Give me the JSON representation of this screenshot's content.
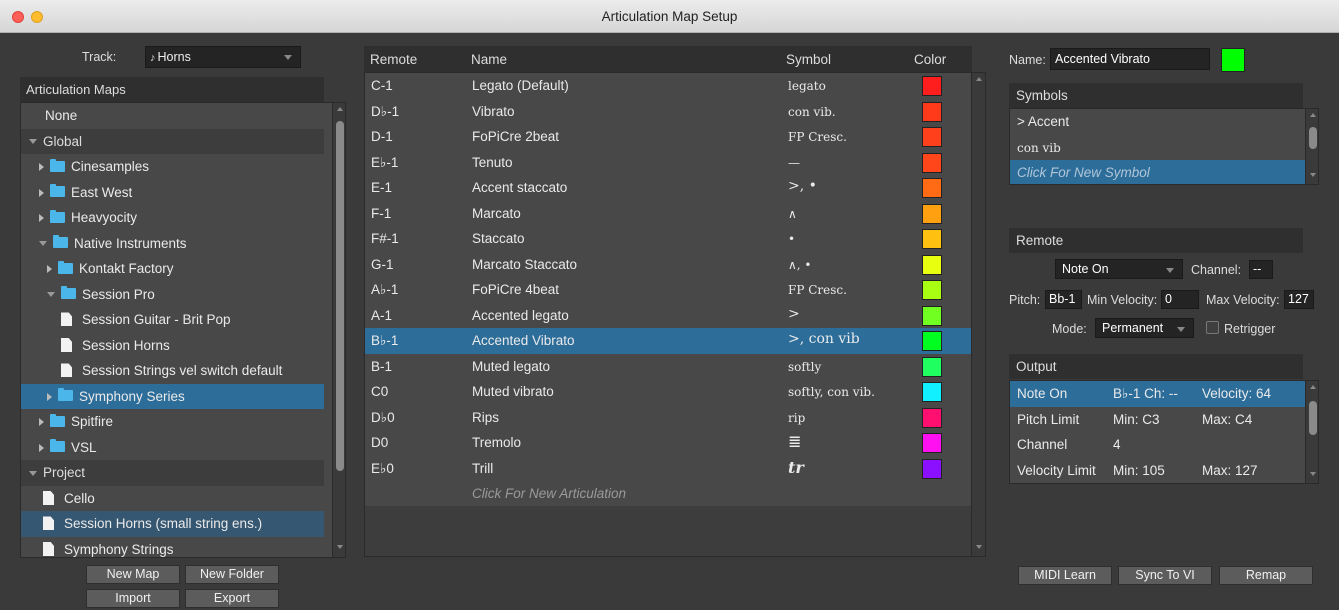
{
  "window": {
    "title": "Articulation Map Setup"
  },
  "left": {
    "track_label": "Track:",
    "track_value": "Horns",
    "maps_header": "Articulation Maps",
    "tree": [
      {
        "label": "None",
        "kind": "item",
        "indent": 0
      },
      {
        "label": "Global",
        "kind": "section",
        "indent": 0
      },
      {
        "label": "Cinesamples",
        "kind": "folder-closed",
        "indent": 1
      },
      {
        "label": "East West",
        "kind": "folder-closed",
        "indent": 1
      },
      {
        "label": "Heavyocity",
        "kind": "folder-closed",
        "indent": 1
      },
      {
        "label": "Native Instruments",
        "kind": "folder-open",
        "indent": 1
      },
      {
        "label": "Kontakt Factory",
        "kind": "folder-closed",
        "indent": 2
      },
      {
        "label": "Session Pro",
        "kind": "folder-open",
        "indent": 2
      },
      {
        "label": "Session Guitar - Brit Pop",
        "kind": "doc",
        "indent": 3
      },
      {
        "label": "Session Horns",
        "kind": "doc",
        "indent": 3
      },
      {
        "label": "Session Strings vel switch default",
        "kind": "doc",
        "indent": 3
      },
      {
        "label": "Symphony Series",
        "kind": "folder-closed",
        "indent": 2,
        "selected": true
      },
      {
        "label": "Spitfire",
        "kind": "folder-closed",
        "indent": 1
      },
      {
        "label": "VSL",
        "kind": "folder-closed",
        "indent": 1
      },
      {
        "label": "Project",
        "kind": "section",
        "indent": 0
      },
      {
        "label": "Cello",
        "kind": "doc",
        "indent": 1
      },
      {
        "label": "Session Horns (small string ens.)",
        "kind": "doc",
        "indent": 1,
        "selected2": true
      },
      {
        "label": "Symphony Strings",
        "kind": "doc",
        "indent": 1
      }
    ],
    "buttons": {
      "new_map": "New Map",
      "new_folder": "New Folder",
      "import": "Import",
      "export": "Export"
    }
  },
  "table": {
    "headers": {
      "remote": "Remote",
      "name": "Name",
      "symbol": "Symbol",
      "color": "Color"
    },
    "rows": [
      {
        "remote": "C-1",
        "name": "Legato (Default)",
        "symbol": "legato",
        "color": "#ff1e1e"
      },
      {
        "remote": "D♭-1",
        "name": "Vibrato",
        "symbol": "con vib.",
        "color": "#ff3a1a"
      },
      {
        "remote": "D-1",
        "name": "FoPiCre 2beat",
        "symbol": "FP Cresc.",
        "color": "#ff401a"
      },
      {
        "remote": "E♭-1",
        "name": "Tenuto",
        "symbol": "—",
        "color": "#ff451a"
      },
      {
        "remote": "E-1",
        "name": "Accent staccato",
        "symbol": ">, •",
        "color": "#ff6a14"
      },
      {
        "remote": "F-1",
        "name": "Marcato",
        "symbol": "∧",
        "color": "#ffa011"
      },
      {
        "remote": "F#-1",
        "name": "Staccato",
        "symbol": "•",
        "color": "#ffc010"
      },
      {
        "remote": "G-1",
        "name": "Marcato Staccato",
        "symbol": "∧, •",
        "color": "#e8ff10"
      },
      {
        "remote": "A♭-1",
        "name": "FoPiCre 4beat",
        "symbol": "FP Cresc.",
        "color": "#a8ff12"
      },
      {
        "remote": "A-1",
        "name": "Accented legato",
        "symbol": ">",
        "color": "#70ff20"
      },
      {
        "remote": "B♭-1",
        "name": "Accented Vibrato",
        "symbol": ">, con vib",
        "color": "#00ff20",
        "selected": true
      },
      {
        "remote": "B-1",
        "name": "Muted legato",
        "symbol": "softly",
        "color": "#20ff60"
      },
      {
        "remote": "C0",
        "name": "Muted vibrato",
        "symbol": "softly, con vib.",
        "color": "#10f0ff"
      },
      {
        "remote": "D♭0",
        "name": "Rips",
        "symbol": "rip",
        "color": "#ff1070"
      },
      {
        "remote": "D0",
        "name": "Tremolo",
        "symbol": "≣",
        "color": "#ff10f0"
      },
      {
        "remote": "E♭0",
        "name": "Trill",
        "symbol": "tr",
        "color": "#8a10ff"
      }
    ],
    "new_row": "Click For New Articulation"
  },
  "right": {
    "name_label": "Name:",
    "name_value": "Accented Vibrato",
    "name_color": "#00ff00",
    "symbols_header": "Symbols",
    "symbols": [
      {
        "label": "> Accent",
        "serif": false,
        "selected": false
      },
      {
        "label": "con vib",
        "serif": true,
        "selected": false
      },
      {
        "label": "Click For New Symbol",
        "serif": false,
        "selected": true,
        "new": true
      }
    ],
    "remote_header": "Remote",
    "remote_type": "Note On",
    "channel_label": "Channel:",
    "channel_value": "--",
    "pitch_label": "Pitch:",
    "pitch_value": "Bb-1",
    "min_velocity_label": "Min Velocity:",
    "min_velocity_value": "0",
    "max_velocity_label": "Max Velocity:",
    "max_velocity_value": "127",
    "mode_label": "Mode:",
    "mode_value": "Permanent",
    "retrigger_label": "Retrigger",
    "output_header": "Output",
    "output_rows": [
      {
        "c1": "Note On",
        "c2": "B♭-1  Ch: --",
        "c3": "Velocity: 64",
        "selected": true
      },
      {
        "c1": "Pitch Limit",
        "c2": "Min: C3",
        "c3": "Max: C4"
      },
      {
        "c1": "Channel",
        "c2": "4",
        "c3": ""
      },
      {
        "c1": "Velocity Limit",
        "c2": "Min: 105",
        "c3": "Max: 127"
      }
    ],
    "buttons": {
      "midi_learn": "MIDI Learn",
      "sync_to_vi": "Sync To VI",
      "remap": "Remap"
    }
  }
}
